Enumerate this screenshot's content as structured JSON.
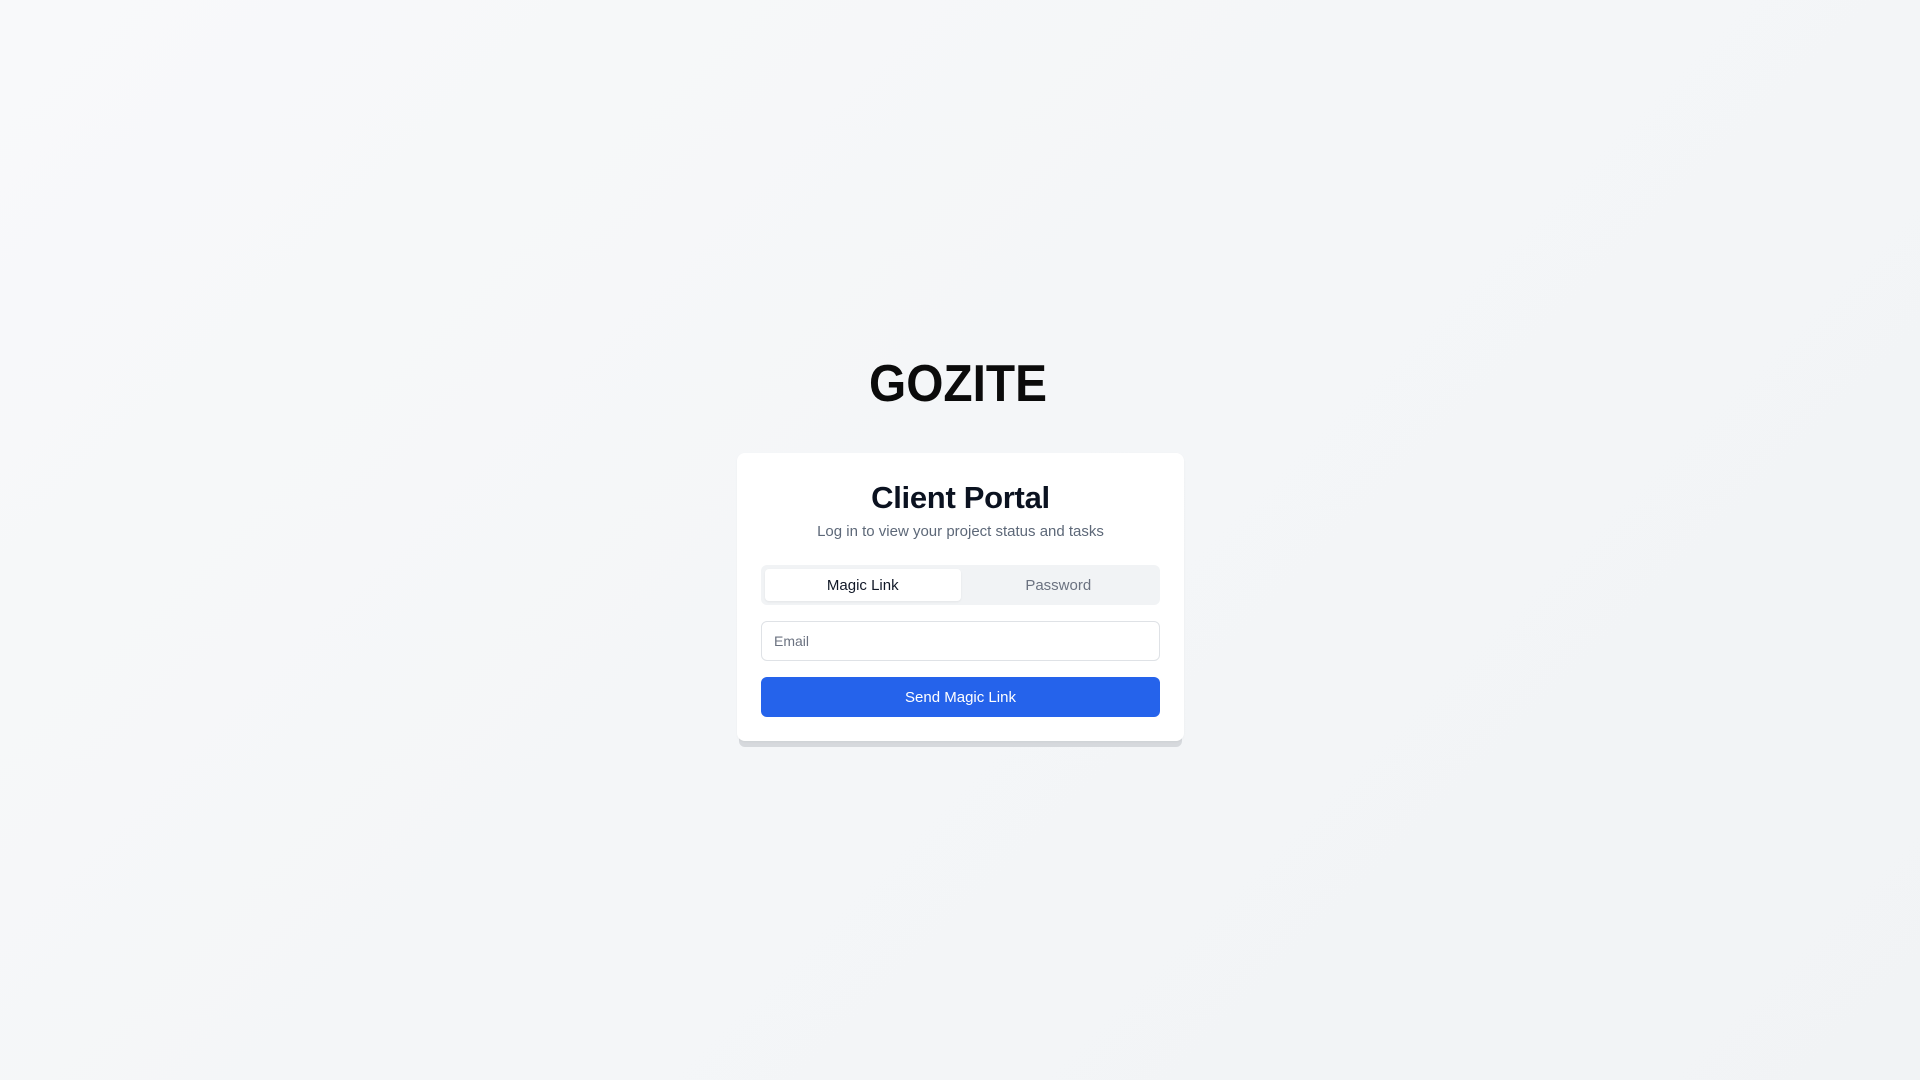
{
  "brand": {
    "logo_text": "GOZITE"
  },
  "login": {
    "title": "Client Portal",
    "subtitle": "Log in to view your project status and tasks",
    "tabs": [
      {
        "label": "Magic Link",
        "active": true
      },
      {
        "label": "Password",
        "active": false
      }
    ],
    "email": {
      "value": "",
      "placeholder": "Email"
    },
    "submit_label": "Send Magic Link"
  },
  "colors": {
    "accent": "#2563eb",
    "text_primary": "#0b1220",
    "text_muted": "#5d6878",
    "card_bg": "#ffffff",
    "page_bg": "#f5f6f8"
  }
}
